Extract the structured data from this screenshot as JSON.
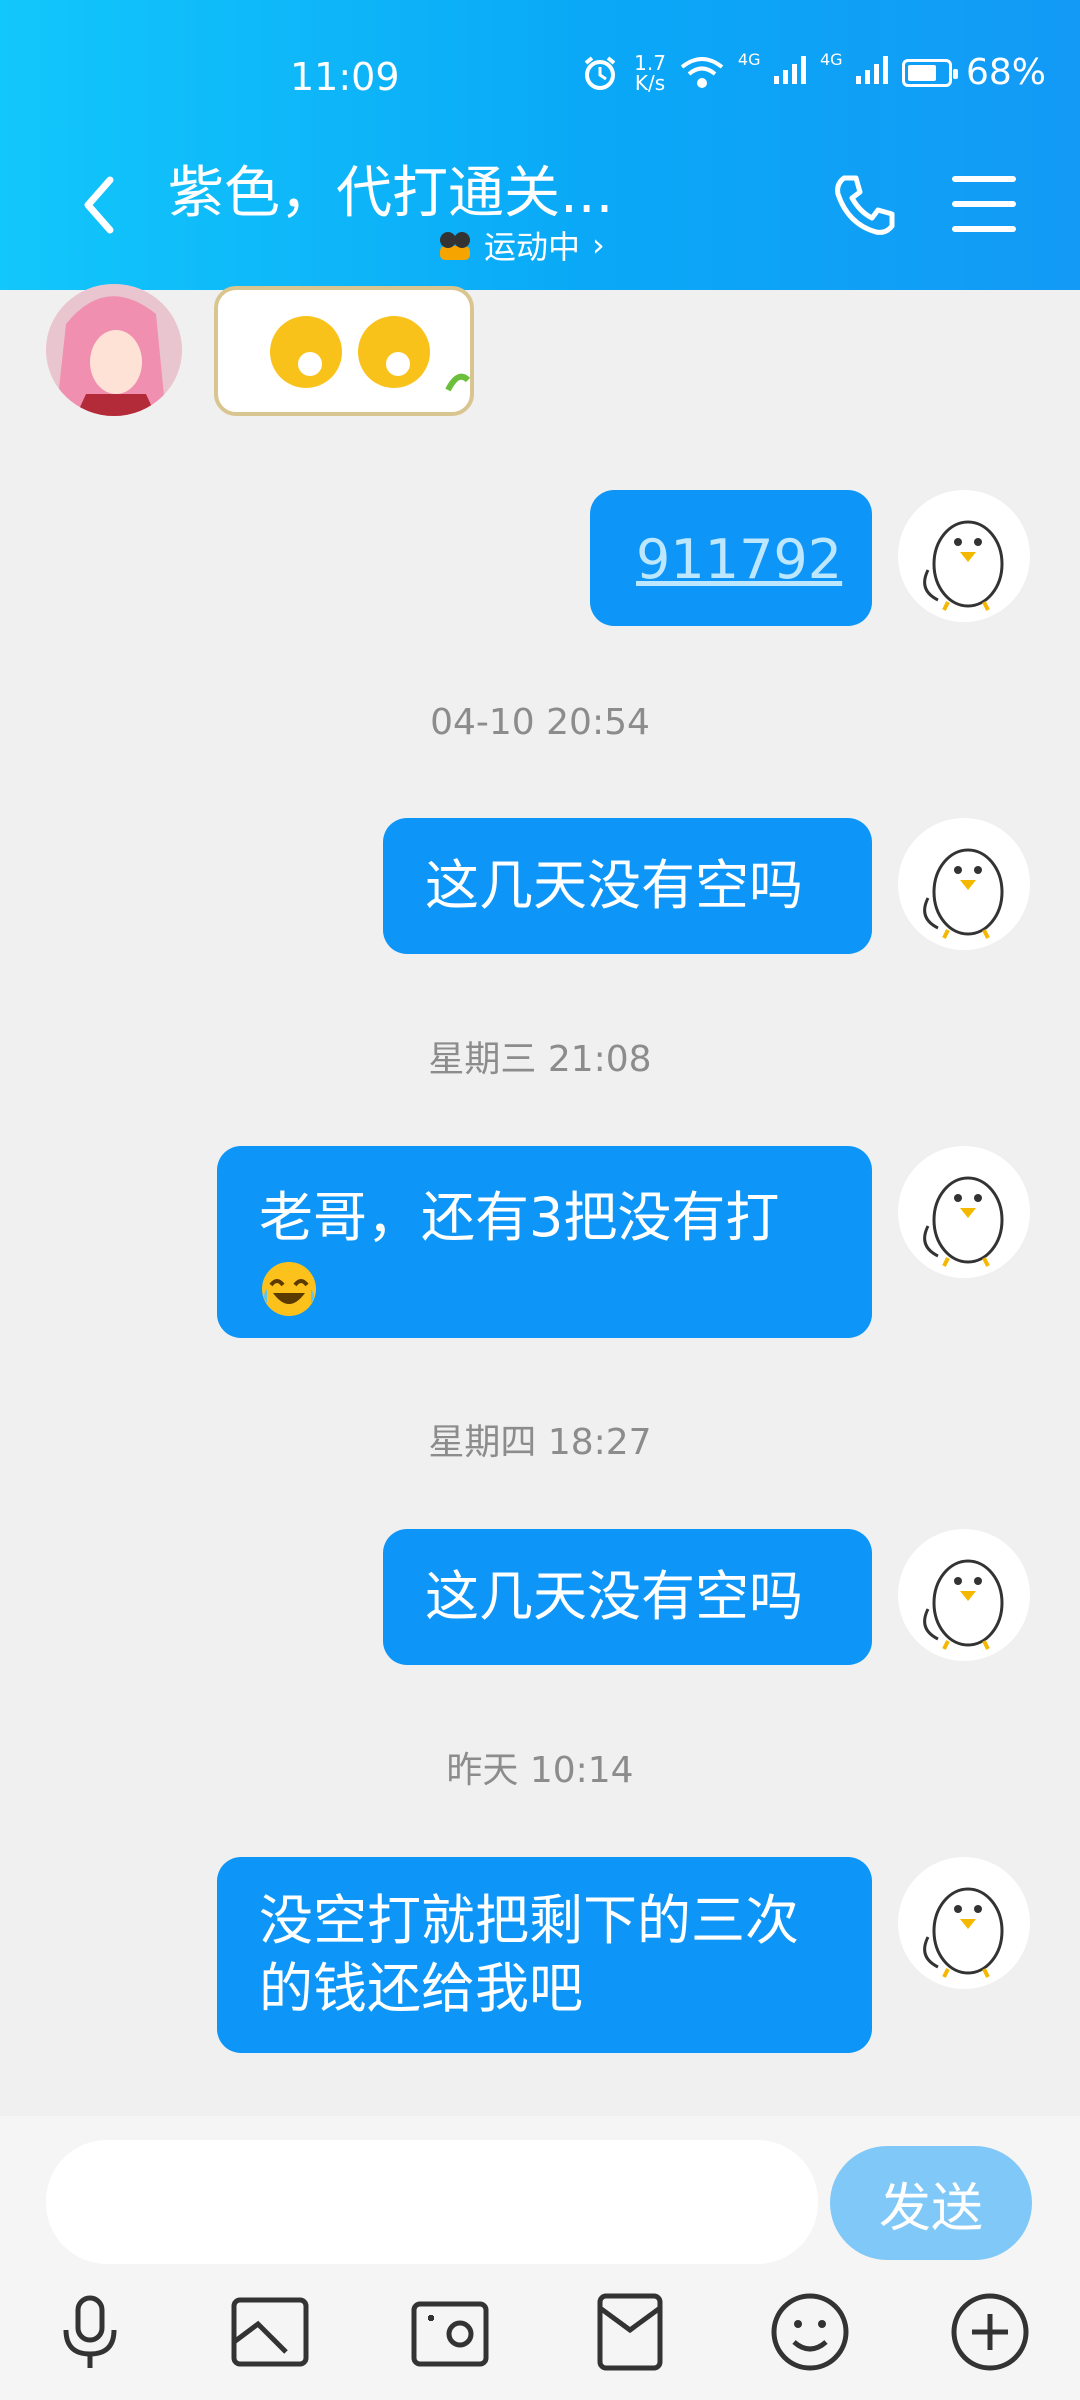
{
  "status_bar": {
    "time": "11:09",
    "net_speed_top": "1.7",
    "net_speed_bottom": "K/s",
    "signal1": "4G",
    "signal2": "4G",
    "battery": "68%"
  },
  "header": {
    "title": "紫色，代打通关...",
    "status": "运动中",
    "status_chevron": "›"
  },
  "messages": [
    {
      "type": "text",
      "text": "911792"
    },
    {
      "type": "timestamp",
      "text": "04-10 20:54"
    },
    {
      "type": "text",
      "text": "这几天没有空吗"
    },
    {
      "type": "timestamp",
      "text": "星期三 21:08"
    },
    {
      "type": "text",
      "text": "老哥，还有3把没有打"
    },
    {
      "type": "timestamp",
      "text": "星期四 18:27"
    },
    {
      "type": "text",
      "text": "这几天没有空吗"
    },
    {
      "type": "timestamp",
      "text": "昨天 10:14"
    },
    {
      "type": "text",
      "text": "没空打就把剩下的三次的钱还给我吧"
    }
  ],
  "input": {
    "placeholder": ""
  },
  "send_label": "发送",
  "colors": {
    "header_start": "#12c7fb",
    "header_end": "#139af6",
    "bubble": "#0d96f7",
    "send_disabled": "#80c8f8"
  }
}
